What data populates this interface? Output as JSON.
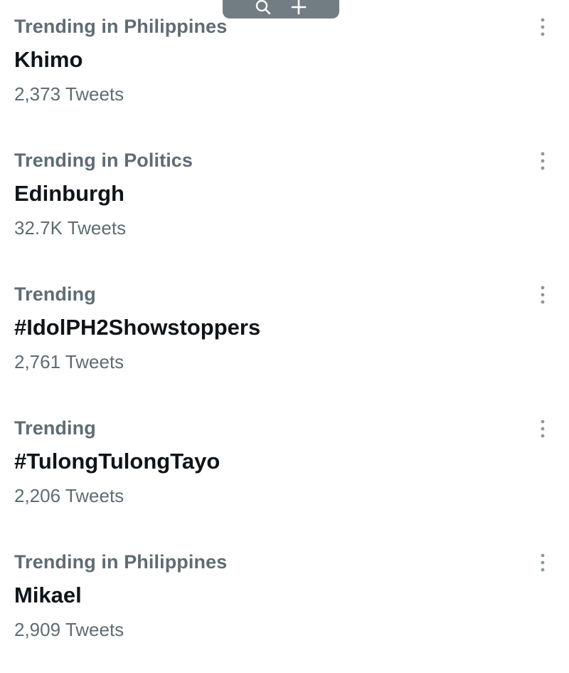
{
  "toolbar": {
    "icons": [
      "search-icon",
      "plus-icon"
    ]
  },
  "trends": [
    {
      "context": "Trending in Philippines",
      "topic": "Khimo",
      "count": "2,373 Tweets"
    },
    {
      "context": "Trending in Politics",
      "topic": "Edinburgh",
      "count": "32.7K Tweets"
    },
    {
      "context": "Trending",
      "topic": "#IdolPH2Showstoppers",
      "count": "2,761 Tweets"
    },
    {
      "context": "Trending",
      "topic": "#TulongTulongTayo",
      "count": "2,206 Tweets"
    },
    {
      "context": "Trending in Philippines",
      "topic": "Mikael",
      "count": "2,909 Tweets"
    }
  ],
  "colors": {
    "primary_text": "#0f1419",
    "secondary_text": "#5f6c73",
    "pill_background": "#727d83"
  }
}
